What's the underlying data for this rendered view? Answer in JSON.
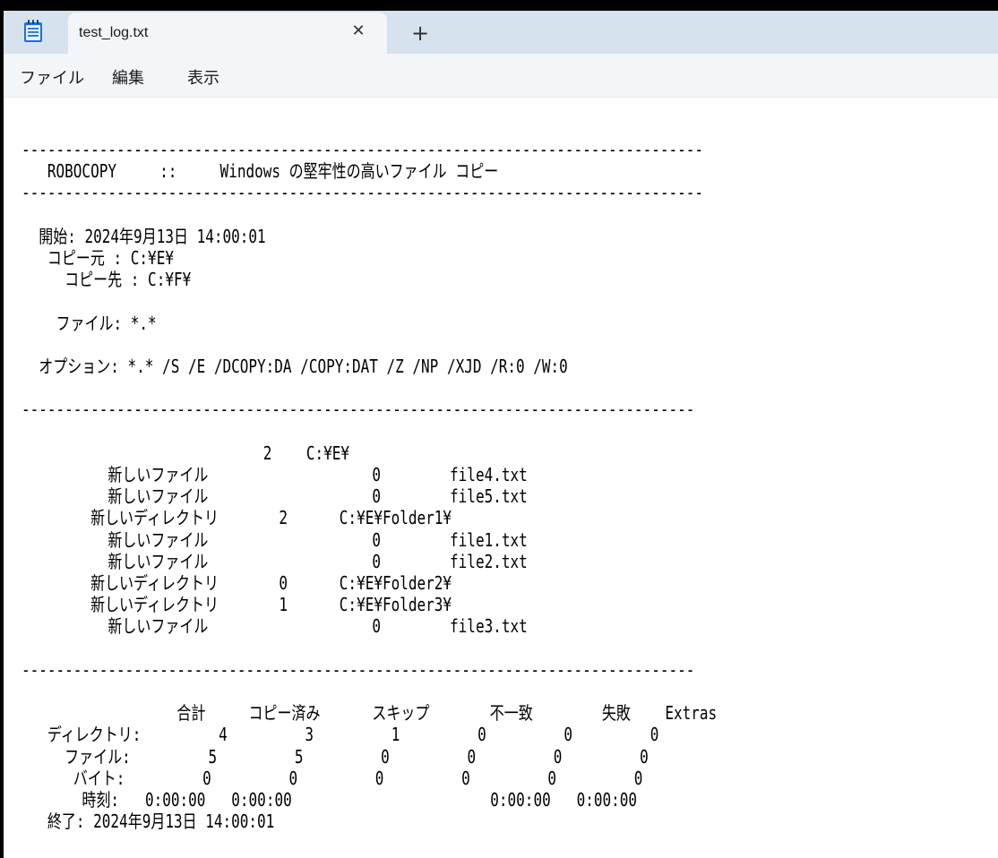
{
  "tab": {
    "title": "test_log.txt",
    "close_symbol": "✕",
    "new_tab_symbol": "+"
  },
  "icons": {
    "app": "notepad-icon",
    "close": "close-icon",
    "new_tab": "plus-icon"
  },
  "menu": {
    "file": "ファイル",
    "edit": "編集",
    "view": "表示"
  },
  "document": {
    "content": "-------------------------------------------------------------------------------\n   ROBOCOPY     ::     Windows の堅牢性の高いファイル コピー\n-------------------------------------------------------------------------------\n\n  開始: 2024年9月13日 14:00:01\n   コピー元 : C:¥E¥\n     コピー先 : C:¥F¥\n\n    ファイル: *.*\n\n  オプション: *.* /S /E /DCOPY:DA /COPY:DAT /Z /NP /XJD /R:0 /W:0\n\n------------------------------------------------------------------------------\n\n                            2    C:¥E¥\n          新しいファイル                   0        file4.txt\n          新しいファイル                   0        file5.txt\n        新しいディレクトリ       2      C:¥E¥Folder1¥\n          新しいファイル                   0        file1.txt\n          新しいファイル                   0        file2.txt\n        新しいディレクトリ       0      C:¥E¥Folder2¥\n        新しいディレクトリ       1      C:¥E¥Folder3¥\n          新しいファイル                   0        file3.txt\n\n------------------------------------------------------------------------------\n\n                  合計     コピー済み      スキップ       不一致        失敗    Extras\n   ディレクトリ:         4         3         1         0         0         0\n     ファイル:         5         5         0         0         0         0\n      バイト:         0         0         0         0         0         0\n       時刻:   0:00:00   0:00:00                       0:00:00   0:00:00\n   終了: 2024年9月13日 14:00:01"
  },
  "colors": {
    "titlebar": "#d6e3ee",
    "tab": "#f3f6f9",
    "menubar": "#f3f6f9",
    "editor": "#ffffff",
    "icon_blue": "#1e6fd9"
  }
}
